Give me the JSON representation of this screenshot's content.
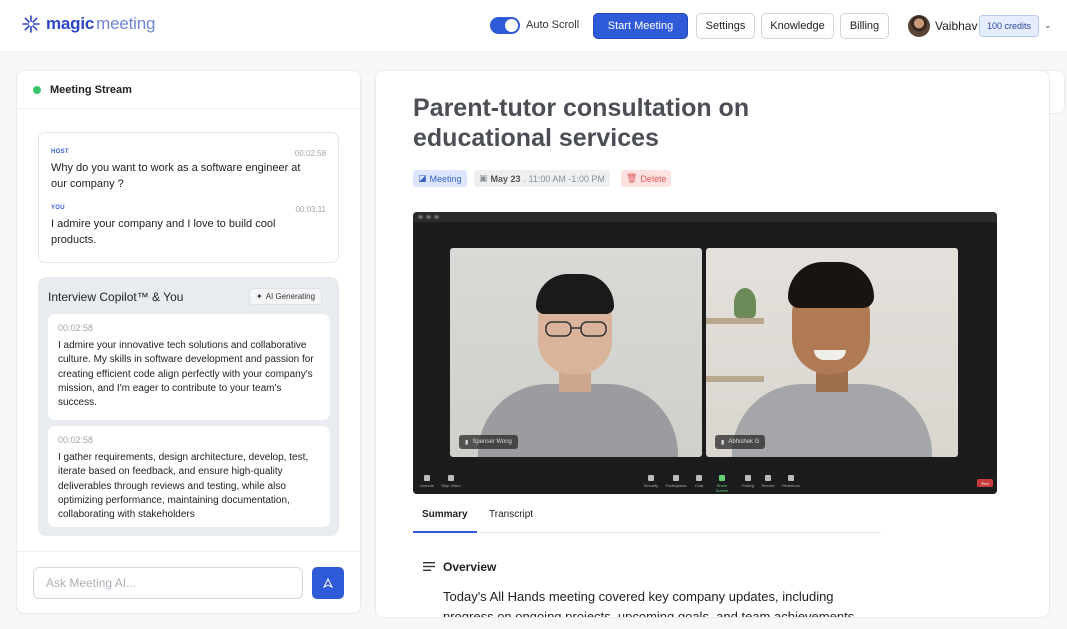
{
  "header": {
    "logo_bold": "magic",
    "logo_light": "meeting",
    "auto_scroll_label": "Auto Scroll",
    "start_meeting": "Start Meeting",
    "settings": "Settings",
    "knowledge": "Knowledge",
    "billing": "Billing",
    "user_name": "Vaibhav",
    "credits": "100 credits",
    "accent_color": "#2f5bd9"
  },
  "stream": {
    "title": "Meeting Stream",
    "messages": [
      {
        "role": "HOST",
        "time": "00:02:58",
        "text": "Why do you want to work as a software engineer at our company ?"
      },
      {
        "role": "YOU",
        "time": "00:03:11",
        "text": "I admire your company and I love to build cool products."
      }
    ]
  },
  "copilot": {
    "title": "Interview Copilot™ & You",
    "badge": "AI Generating",
    "cards": [
      {
        "time": "00:02:58",
        "text": "I admire your innovative tech solutions and collaborative culture. My skills in software development and passion for creating efficient code align perfectly with your company's mission, and I'm eager to contribute to your team's success."
      },
      {
        "time": "00:02:58",
        "text": "I gather requirements, design architecture, develop, test, iterate based on feedback, and ensure high-quality deliverables through reviews and testing, while also optimizing performance, maintaining documentation, collaborating with stakeholders"
      }
    ]
  },
  "ask": {
    "placeholder": "Ask Meeting AI..."
  },
  "meeting": {
    "title": "Parent-tutor consultation on educational services",
    "type_chip": "Meeting",
    "date": "May 23",
    "time_range": ". 11:00 AM -1:00 PM",
    "delete": "Delete",
    "participants": [
      "Spenser Wong",
      "Abhishek G"
    ],
    "toolbar": [
      "Unmute",
      "Stop Video",
      "Security",
      "Participants",
      "Chat",
      "Share Screen",
      "Polling",
      "Record",
      "Reactions"
    ],
    "end_label": "End"
  },
  "tabs": [
    "Summary",
    "Transcript"
  ],
  "overview": {
    "title": "Overview",
    "text": "Today's All Hands meeting covered key company updates, including progress on ongoing projects, upcoming goals, and team achievements."
  }
}
